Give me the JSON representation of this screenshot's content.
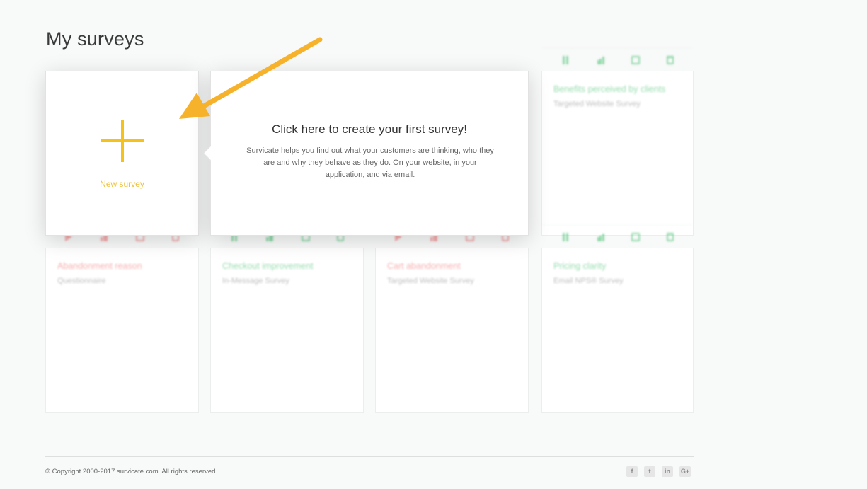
{
  "page": {
    "title": "My surveys"
  },
  "new_survey": {
    "label": "New survey"
  },
  "hint": {
    "title": "Click here to create your first survey!",
    "text": "Survicate helps you find out what your customers are thinking, who they are and why they behave as they do. On your website, in your application, and via email."
  },
  "surveys": [
    {
      "title": "Benefits perceived by clients",
      "type": "Targeted Website Survey",
      "status": "active"
    },
    {
      "title": "Abandonment reason",
      "type": "Questionnaire",
      "status": "paused"
    },
    {
      "title": "Checkout improvement",
      "type": "In-Message Survey",
      "status": "active"
    },
    {
      "title": "Cart abandonment",
      "type": "Targeted Website Survey",
      "status": "paused"
    },
    {
      "title": "Pricing clarity",
      "type": "Email NPS® Survey",
      "status": "active"
    }
  ],
  "colors": {
    "accent": "#f4c21a",
    "arrow": "#f7b22b",
    "active": "#3fbf6a",
    "paused": "#f06a6a"
  },
  "footer": {
    "copyright": "© Copyright 2000-2017 survicate.com. All rights reserved.",
    "social": [
      {
        "icon": "facebook-icon",
        "glyph": "f"
      },
      {
        "icon": "twitter-icon",
        "glyph": "t"
      },
      {
        "icon": "linkedin-icon",
        "glyph": "in"
      },
      {
        "icon": "google-plus-icon",
        "glyph": "G+"
      }
    ]
  }
}
